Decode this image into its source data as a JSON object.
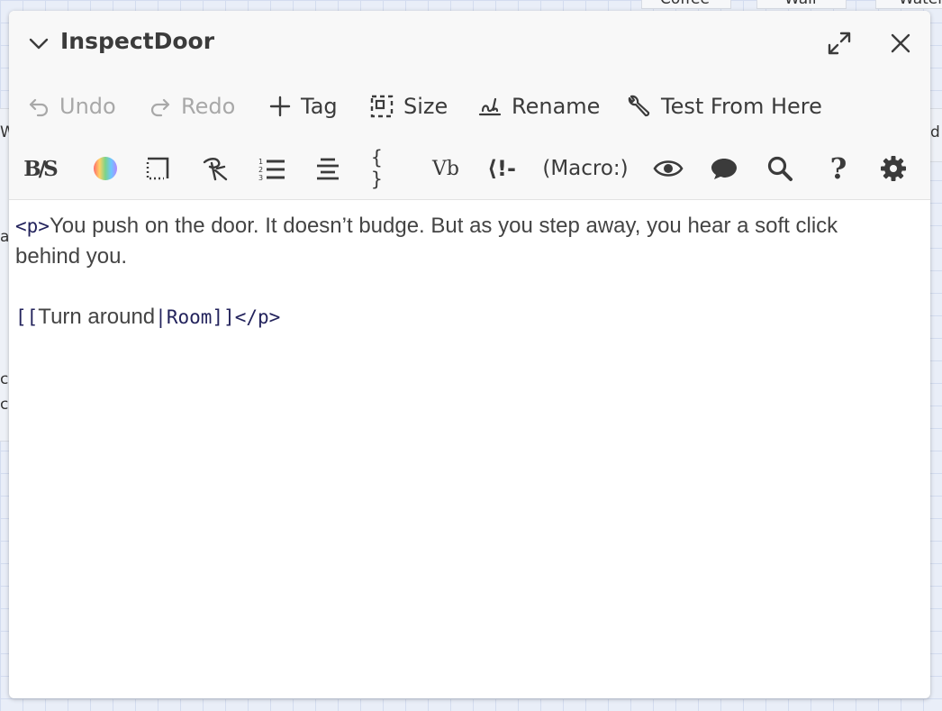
{
  "background": {
    "top_cards": [
      "Coffee",
      "Wall",
      "Water"
    ],
    "left_fragments": [
      "W",
      "a",
      "c",
      "c"
    ],
    "right_fragment": "d"
  },
  "dialog": {
    "title": "InspectDoor",
    "collapse_icon": "chevron-down-icon",
    "maximize_icon": "maximize-icon",
    "close_icon": "close-icon"
  },
  "toolbar": {
    "undo": "Undo",
    "redo": "Redo",
    "tag": "Tag",
    "size": "Size",
    "rename": "Rename",
    "test_from_here": "Test From Here"
  },
  "format_toolbar": {
    "strikethrough_glyph": "B/S",
    "verbatim_glyph": "Vb",
    "braces_glyph": "{ }",
    "comment_glyph": "⟨!-",
    "macro_label": "(Macro:)",
    "help_glyph": "?",
    "colors": [
      "#ff6b6b",
      "#ffd166",
      "#7bd389",
      "#6ec6ff",
      "#b388ff"
    ]
  },
  "editor": {
    "line1_tag_open": "<p>",
    "line1_text": "You push on the door. It doesn’t budge. But as you step away, you hear a soft click",
    "line2_text": "behind you.",
    "link_open": "[[",
    "link_text": "Turn around",
    "link_sep": "|",
    "link_target": "Room",
    "link_close": "]]",
    "tag_close": "</p>"
  }
}
